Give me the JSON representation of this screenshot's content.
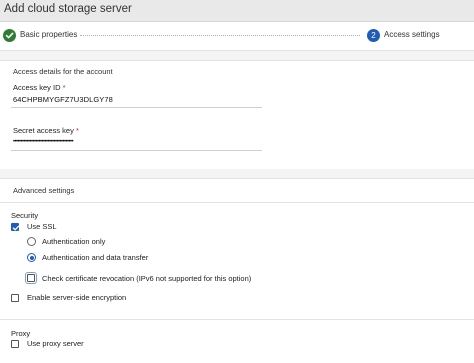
{
  "header": {
    "title": "Add cloud storage server"
  },
  "wizard": {
    "steps": [
      {
        "label": "Basic properties",
        "status": "completed",
        "icon": "check-icon"
      },
      {
        "label": "Access settings",
        "status": "current",
        "number": "2"
      }
    ]
  },
  "access_details": {
    "section_title": "Access details for the account",
    "access_key_label": "Access key ID",
    "access_key_required": "*",
    "access_key_value": "64CHPBMYGFZ7U3DLGY78",
    "secret_key_label": "Secret access key",
    "secret_key_required": "*",
    "secret_key_value": "••••••••••••••••••••••••••••••••••••••••"
  },
  "advanced": {
    "section_title": "Advanced settings",
    "security": {
      "title": "Security",
      "use_ssl_label": "Use SSL",
      "use_ssl_checked": true,
      "auth_only_label": "Authentication only",
      "auth_transfer_label": "Authentication and data transfer",
      "selected_option": "Authentication and data transfer",
      "cert_revocation_label": "Check certificate revocation (IPv6 not supported for this option)",
      "cert_revocation_checked": false,
      "server_side_encryption_label": "Enable server-side encryption",
      "server_side_encryption_checked": false
    },
    "proxy": {
      "title": "Proxy",
      "use_proxy_label": "Use proxy server",
      "use_proxy_checked": false
    }
  },
  "colors": {
    "accent": "#1f5eb8",
    "success": "#2e7d32",
    "required": "#c62828",
    "header_bg": "#e9e9e9"
  }
}
